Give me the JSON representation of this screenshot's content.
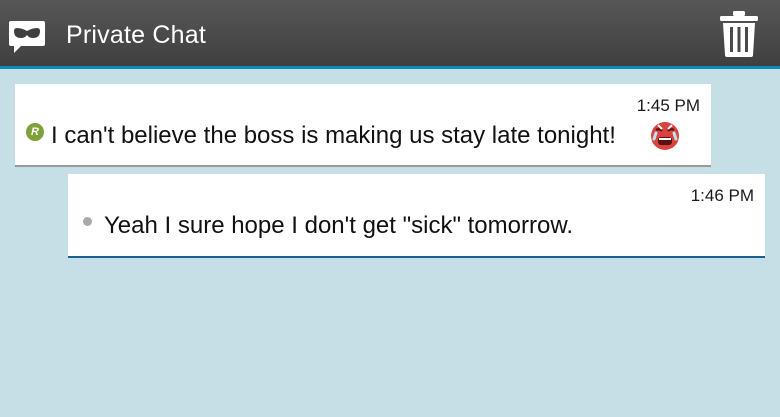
{
  "header": {
    "title": "Private Chat",
    "app_icon": "private-chat-mask-icon",
    "delete_icon": "trash-icon",
    "accent_color": "#0a8ab8"
  },
  "messages": [
    {
      "direction": "received",
      "sender_initial": "R",
      "time": "1:45 PM",
      "text": "I can't believe the boss is making us stay late tonight!",
      "emoji": "crying-angry-face-icon"
    },
    {
      "direction": "sent",
      "time": "1:46 PM",
      "text": "Yeah I sure hope I don't get \"sick\" tomorrow."
    }
  ]
}
